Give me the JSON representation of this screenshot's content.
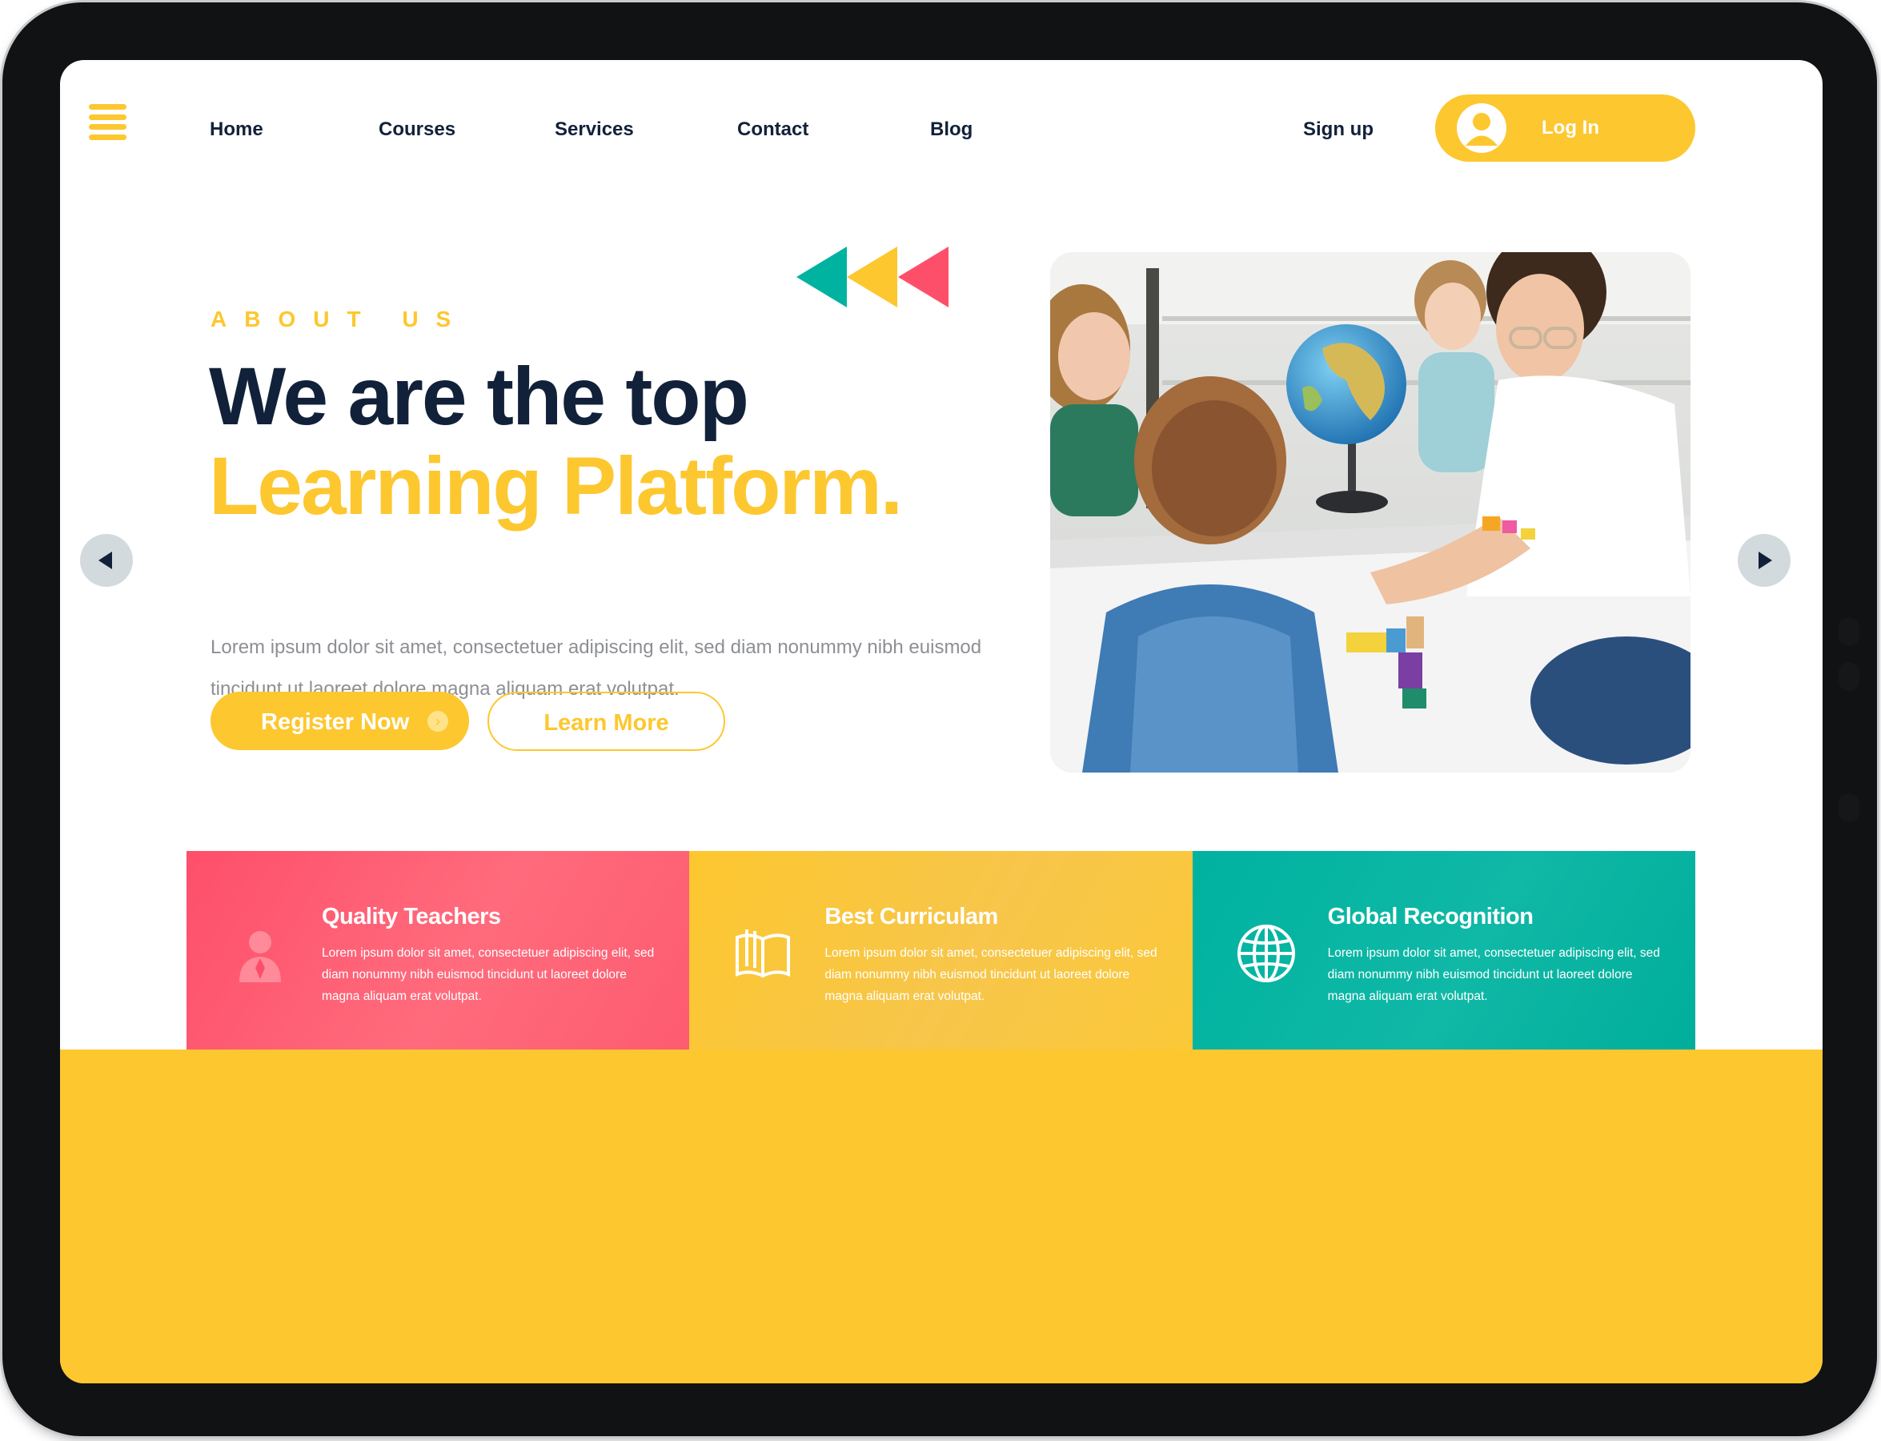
{
  "nav": {
    "links": [
      "Home",
      "Courses",
      "Services",
      "Contact",
      "Blog"
    ],
    "signup": "Sign up",
    "login": "Log In"
  },
  "hero": {
    "eyebrow": "ABOUT US",
    "title_line1": "We are the top",
    "title_line2": "Learning Platform.",
    "description": "Lorem ipsum dolor sit amet, consectetuer adipiscing elit, sed diam nonummy nibh euismod tincidunt ut laoreet dolore magna aliquam erat volutpat.",
    "register_label": "Register Now",
    "learn_label": "Learn More"
  },
  "features": [
    {
      "title": "Quality Teachers",
      "text": "Lorem ipsum dolor sit amet, consectetuer adipiscing elit, sed diam nonummy nibh euismod tincidunt ut laoreet dolore magna aliquam erat volutpat.",
      "icon": "teacher-icon",
      "color": "#fe4f6a"
    },
    {
      "title": "Best Curriculam",
      "text": "Lorem ipsum dolor sit amet, consectetuer adipiscing elit, sed diam nonummy nibh euismod tincidunt ut laoreet dolore magna aliquam erat volutpat.",
      "icon": "book-icon",
      "color": "#fdc72f"
    },
    {
      "title": "Global Recognition",
      "text": "Lorem ipsum dolor sit amet, consectetuer adipiscing elit, sed diam nonummy nibh euismod tincidunt ut laoreet dolore magna aliquam erat volutpat.",
      "icon": "globe-icon",
      "color": "#00b2a0"
    }
  ],
  "colors": {
    "accent": "#fdc72f",
    "navy": "#12213a",
    "teal": "#00b2a0",
    "coral": "#fe4f6a"
  }
}
